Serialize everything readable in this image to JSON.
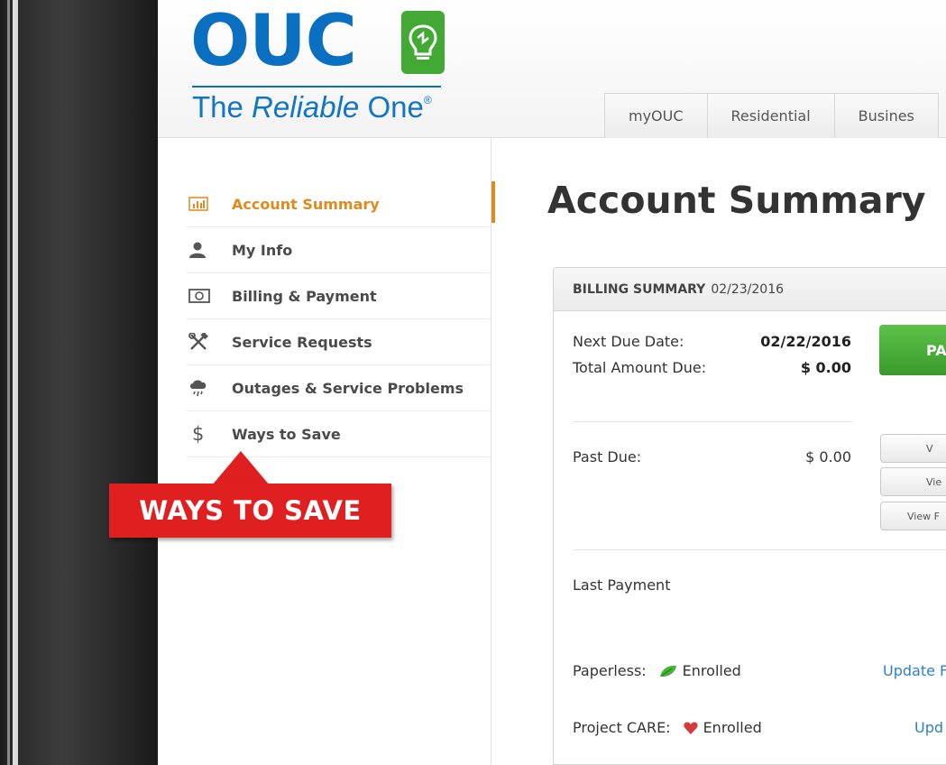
{
  "brand": {
    "logo_text": "OUC",
    "tagline_pre": "The ",
    "tagline_italic": "Reliable",
    "tagline_post": " One",
    "registered": "®"
  },
  "tabs": [
    {
      "label": "myOUC"
    },
    {
      "label": "Residential"
    },
    {
      "label": "Busines"
    }
  ],
  "sidebar": {
    "items": [
      {
        "label": "Account Summary",
        "icon": "bar-chart-icon",
        "active": true
      },
      {
        "label": "My Info",
        "icon": "user-icon"
      },
      {
        "label": "Billing & Payment",
        "icon": "money-bill-icon"
      },
      {
        "label": "Service Requests",
        "icon": "tools-icon"
      },
      {
        "label": "Outages & Service Problems",
        "icon": "storm-cloud-icon"
      },
      {
        "label": "Ways to Save",
        "icon": "dollar-icon"
      }
    ]
  },
  "callout": {
    "text": "WAYS TO SAVE"
  },
  "main": {
    "title": "Account Summary"
  },
  "billing": {
    "header_label": "BILLING SUMMARY",
    "header_date": "02/23/2016",
    "next_due_label": "Next Due Date:",
    "next_due_value": "02/22/2016",
    "total_due_label": "Total Amount Due:",
    "total_due_value": "$ 0.00",
    "pay_button": "PA",
    "past_due_label": "Past Due:",
    "past_due_value": "$ 0.00",
    "buttons": [
      "V",
      "Vie",
      "View F"
    ],
    "last_payment_label": "Last Payment",
    "paperless_label": "Paperless:",
    "paperless_status": "Enrolled",
    "paperless_link": "Update F",
    "care_label": "Project CARE:",
    "care_status": "Enrolled",
    "care_link": "Upd"
  },
  "colors": {
    "brand_blue": "#0a6fc0",
    "brand_green": "#42a935",
    "active_orange": "#e08a1e",
    "callout_red": "#e02020",
    "link_blue": "#2f7fc4"
  }
}
